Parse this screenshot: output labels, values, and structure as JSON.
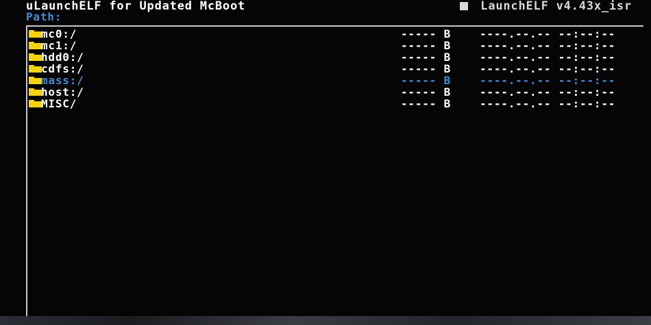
{
  "header": {
    "title": "uLaunchELF for Updated McBoot",
    "version": "LaunchELF v4.43x_isr"
  },
  "path": {
    "label": "Path:"
  },
  "files": [
    {
      "name": "mc0:/",
      "size": "----- B",
      "date": "----.--.-- --:--:--",
      "icon": "folder-icon",
      "selected": false
    },
    {
      "name": "mc1:/",
      "size": "----- B",
      "date": "----.--.-- --:--:--",
      "icon": "folder-icon",
      "selected": false
    },
    {
      "name": "hdd0:/",
      "size": "----- B",
      "date": "----.--.-- --:--:--",
      "icon": "folder-icon",
      "selected": false
    },
    {
      "name": "cdfs:/",
      "size": "----- B",
      "date": "----.--.-- --:--:--",
      "icon": "folder-icon",
      "selected": false
    },
    {
      "name": "mass:/",
      "size": "----- B",
      "date": "----.--.-- --:--:--",
      "icon": "folder-icon",
      "selected": true
    },
    {
      "name": "host:/",
      "size": "----- B",
      "date": "----.--.-- --:--:--",
      "icon": "folder-icon",
      "selected": false
    },
    {
      "name": "MISC/",
      "size": "----- B",
      "date": "----.--.-- --:--:--",
      "icon": "folder-icon",
      "selected": false
    }
  ],
  "colors": {
    "background": "#050505",
    "text": "#ffffff",
    "highlight": "#3f8fd8",
    "folder": "#f4d410"
  }
}
